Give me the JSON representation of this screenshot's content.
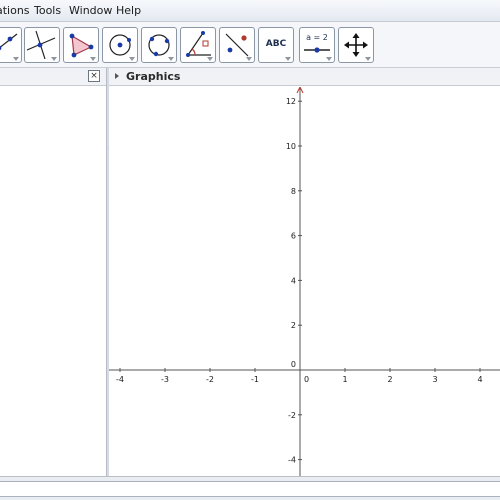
{
  "menu": {
    "options": "ations",
    "tools": "Tools",
    "window": "Window",
    "help": "Help"
  },
  "toolbar": {
    "tools": [
      {
        "name": "line-through-two-points-tool",
        "icon": "line-icon"
      },
      {
        "name": "perpendicular-line-tool",
        "icon": "perpendicular-icon"
      },
      {
        "name": "polygon-tool",
        "icon": "polygon-icon"
      },
      {
        "name": "circle-center-point-tool",
        "icon": "circle-center-icon"
      },
      {
        "name": "circle-three-points-tool",
        "icon": "circle-three-points-icon"
      },
      {
        "name": "angle-tool",
        "icon": "angle-icon"
      },
      {
        "name": "reflect-about-line-tool",
        "icon": "reflect-icon"
      },
      {
        "name": "insert-text-tool",
        "icon": "text-icon",
        "label": "ABC"
      },
      {
        "name": "slider-tool",
        "icon": "slider-icon",
        "label": "a = 2"
      },
      {
        "name": "move-graphics-view-tool",
        "icon": "move-view-icon"
      }
    ],
    "accent": "#1f3f9a",
    "point_color": "#1a3aa8",
    "highlight_color": "#b03a2e"
  },
  "algebra": {
    "close_symbol": "×"
  },
  "graphics": {
    "title": "Graphics",
    "x_ticks": [
      "-4",
      "-3",
      "-2",
      "-1",
      "0",
      "1",
      "2",
      "3",
      "4"
    ],
    "y_ticks": [
      "12",
      "10",
      "8",
      "6",
      "4",
      "2",
      "0",
      "-2",
      "-4"
    ],
    "x_range": [
      -4.1,
      4.1
    ],
    "y_range": [
      -4.4,
      12.6
    ],
    "axis_color": "#555555",
    "arrow_color": "#c0392b"
  }
}
